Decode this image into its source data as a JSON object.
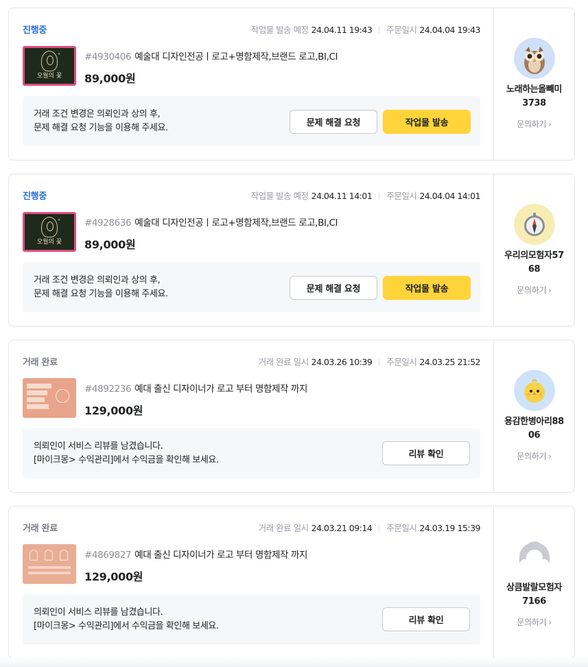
{
  "orders": [
    {
      "status": "진행중",
      "date1_label": "작업물 발송 예정",
      "date1_value": "24.04.11 19:43",
      "date2_label": "주문일시",
      "date2_value": "24.04.04 19:43",
      "order_no": "#4930406",
      "title": "예술대 디자인전공ㅣ로고+명함제작,브랜드 로고,BI,CI",
      "price": "89,000원",
      "notice_line1": "거래 조건 변경은 의뢰인과 상의 후,",
      "notice_line2": "문제 해결 요청 기능을 이용해 주세요.",
      "btn_problem": "문제 해결 요청",
      "btn_send": "작업물 발송",
      "thumb_title": "오월의 꽃",
      "user_line1": "노래하는올빼미",
      "user_line2": "3738",
      "ask": "문의하기"
    },
    {
      "status": "진행중",
      "date1_label": "작업물 발송 예정",
      "date1_value": "24.04.11 14:01",
      "date2_label": "주문일시",
      "date2_value": "24.04.04 14:01",
      "order_no": "#4928636",
      "title": "예술대 디자인전공ㅣ로고+명함제작,브랜드 로고,BI,CI",
      "price": "89,000원",
      "notice_line1": "거래 조건 변경은 의뢰인과 상의 후,",
      "notice_line2": "문제 해결 요청 기능을 이용해 주세요.",
      "btn_problem": "문제 해결 요청",
      "btn_send": "작업물 발송",
      "thumb_title": "오월의 꽃",
      "user_line1": "우리의모험자57",
      "user_line2": "68",
      "ask": "문의하기"
    },
    {
      "status": "거래 완료",
      "date1_label": "거래 완료 일시",
      "date1_value": "24.03.26 10:39",
      "date2_label": "주문일시",
      "date2_value": "24.03.25 21:52",
      "order_no": "#4892236",
      "title": "예대 출신 디자이너가 로고 부터 명함제작 까지",
      "price": "129,000원",
      "notice_line1": "의뢰인이 서비스 리뷰를 남겼습니다.",
      "notice_line2": "[마이크몽> 수익관리]에서 수익금을 확인해 보세요.",
      "btn_review": "리뷰 확인",
      "user_line1": "용감한병아리88",
      "user_line2": "06",
      "ask": "문의하기"
    },
    {
      "status": "거래 완료",
      "date1_label": "거래 완료 일시",
      "date1_value": "24.03.21 09:14",
      "date2_label": "주문일시",
      "date2_value": "24.03.19 15:39",
      "order_no": "#4869827",
      "title": "예대 출신 디자이너가 로고 부터 명함제작 까지",
      "price": "129,000원",
      "notice_line1": "의뢰인이 서비스 리뷰를 남겼습니다.",
      "notice_line2": "[마이크몽> 수익관리]에서 수익금을 확인해 보세요.",
      "btn_review": "리뷰 확인",
      "user_line1": "상큼발랄모험자",
      "user_line2": "7166",
      "ask": "문의하기"
    }
  ],
  "colors": {
    "status_in_progress": "#2b6fd9",
    "status_done": "#7a7d85",
    "primary_button": "#ffd43b",
    "border": "#e4e5ed",
    "notice_bg": "#f6f7f9"
  },
  "icons": {
    "chevron": "chevron-right-icon"
  }
}
